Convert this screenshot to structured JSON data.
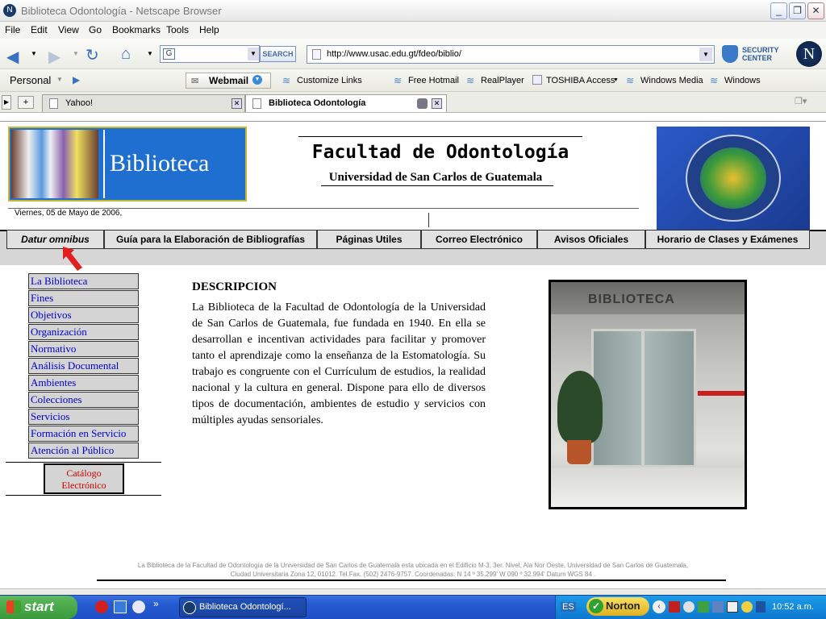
{
  "window": {
    "title": "Biblioteca Odontología - Netscape Browser"
  },
  "menu": [
    "File",
    "Edit",
    "View",
    "Go",
    "Bookmarks",
    "Tools",
    "Help"
  ],
  "toolbar": {
    "search_button": "SEARCH",
    "url": "http://www.usac.edu.gt/fdeo/biblio/",
    "security_center": "SECURITY CENTER"
  },
  "personal_bar": {
    "personal": "Personal",
    "webmail": "Webmail",
    "links": [
      "Customize Links",
      "Free Hotmail",
      "RealPlayer",
      "TOSHIBA Access",
      "Windows Media",
      "Windows"
    ]
  },
  "tabs": [
    {
      "label": "Yahoo!"
    },
    {
      "label": "Biblioteca Odontología"
    }
  ],
  "header": {
    "banner_text": "Biblioteca",
    "title": "Facultad de Odontología",
    "subtitle": "Universidad de San Carlos de Guatemala",
    "date": "Viernes, 05 de Mayo de 2006,"
  },
  "nav": [
    "Datur omnibus",
    "Guía para la Elaboración de Bibliografías",
    "Páginas Utiles",
    "Correo Electrónico",
    "Avisos Oficiales",
    "Horario de Clases y Exámenes"
  ],
  "sidebar": {
    "items": [
      "La Biblioteca",
      "Fines",
      "Objetivos",
      "Organización",
      "Normativo",
      "Análisis Documental",
      "Ambientes",
      "Colecciones",
      "Servicios",
      "Formación en Servicio",
      "Atención al Público"
    ],
    "catalog_line1": "Catálogo",
    "catalog_line2": "Electrónico"
  },
  "main": {
    "heading": "DESCRIPCION",
    "body": "La Biblioteca de la Facultad de Odontología de la Universidad de San Carlos de Guatemala, fue fundada en 1940. En ella se desarrollan e incentivan actividades para facilitar y promover tanto el aprendizaje como la enseñanza de la Estomatología. Su trabajo es congruente con el Currículum de estudios, la realidad nacional y la cultura en general. Dispone para ello de diversos tipos de documentación, ambientes de estudio y servicios con múltiples ayudas sensoriales.",
    "photo_sign": "BIBLIOTECA"
  },
  "footer": {
    "line1": "La Biblioteca de la Facultad de Odontología de la Universidad de San Carlos de Guatemala esta ubicada en el Edificio M-3, 3er. Nivel, Ala Nor Oeste, Universidad de San Carlos de Guatemala,",
    "line2": "Ciudad Universitaria Zona 12, 01012. Tel.Fax. (502) 2476-9757. Coordenadas: N 14 º 35.299'  W 090 º 32.994'   Datum WGS 84 ."
  },
  "taskbar": {
    "start": "start",
    "task": "Biblioteca Odontologí...",
    "lang": "ES",
    "norton": "Norton",
    "clock": "10:52 a.m."
  },
  "colors": {
    "link": "#0000cc",
    "catalog": "#cc0000",
    "seal_bg": "#1f4fb0",
    "taskbar": "#245ad0"
  }
}
